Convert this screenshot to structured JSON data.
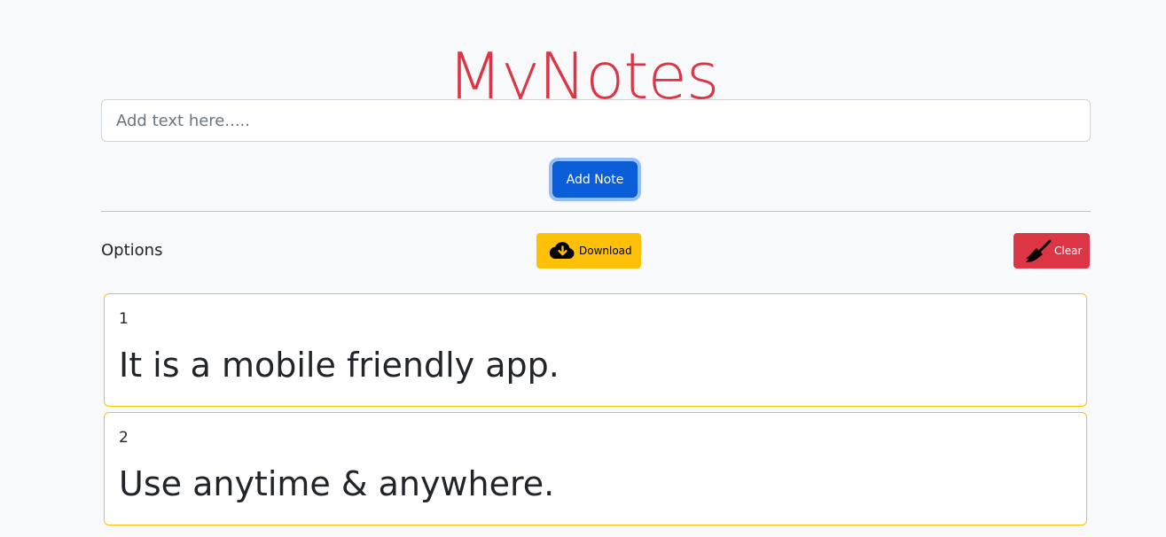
{
  "header": {
    "app_title": "MyNotes"
  },
  "composer": {
    "placeholder": "Add text here.....",
    "value": "",
    "add_button_label": "Add Note"
  },
  "options": {
    "label": "Options",
    "download_label": "Download",
    "download_icon": "cloud-download-icon",
    "clear_label": "Clear",
    "clear_icon": "broom-icon"
  },
  "notes": [
    {
      "number": "1",
      "text": "It is a mobile friendly app."
    },
    {
      "number": "2",
      "text": "Use anytime & anywhere."
    }
  ],
  "colors": {
    "title": "#dc3545",
    "primary": "#0b5ed7",
    "warning": "#ffc107",
    "danger": "#dc3545",
    "background": "#f8f9fa"
  }
}
